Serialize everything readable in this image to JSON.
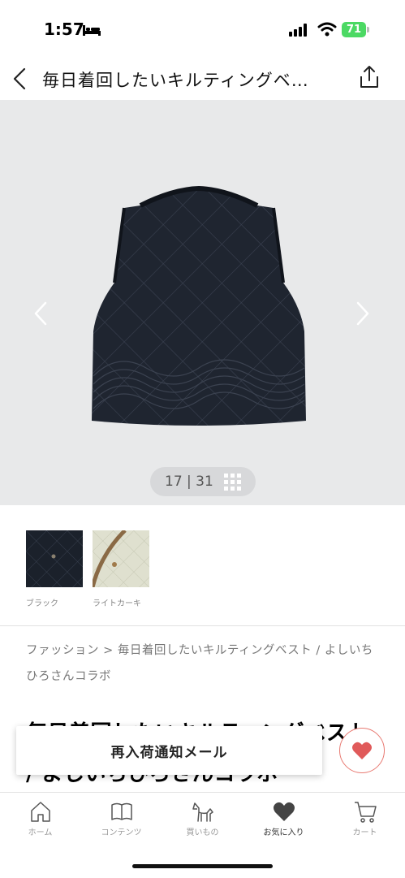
{
  "status": {
    "time": "1:57",
    "battery": "71"
  },
  "nav": {
    "title": "毎日着回したいキルティングベ…"
  },
  "gallery": {
    "counter": "17 | 31"
  },
  "colors": [
    {
      "name": "ブラック"
    },
    {
      "name": "ライトカーキ"
    }
  ],
  "breadcrumb": "ファッション > 毎日着回したいキルティングベスト / よしいちひろさんコラボ",
  "product_title": "毎日着回したいキルティングベスト / よしいちひろさんコラボ",
  "restock_button": "再入荷通知メール",
  "tabs": [
    {
      "label": "ホーム",
      "icon": "home-icon"
    },
    {
      "label": "コンテンツ",
      "icon": "book-icon"
    },
    {
      "label": "買いもの",
      "icon": "dog-icon"
    },
    {
      "label": "お気に入り",
      "icon": "heart-icon"
    },
    {
      "label": "カート",
      "icon": "cart-icon"
    }
  ],
  "theme": {
    "accent": "#e05a5a",
    "battery": "#4cd964"
  }
}
